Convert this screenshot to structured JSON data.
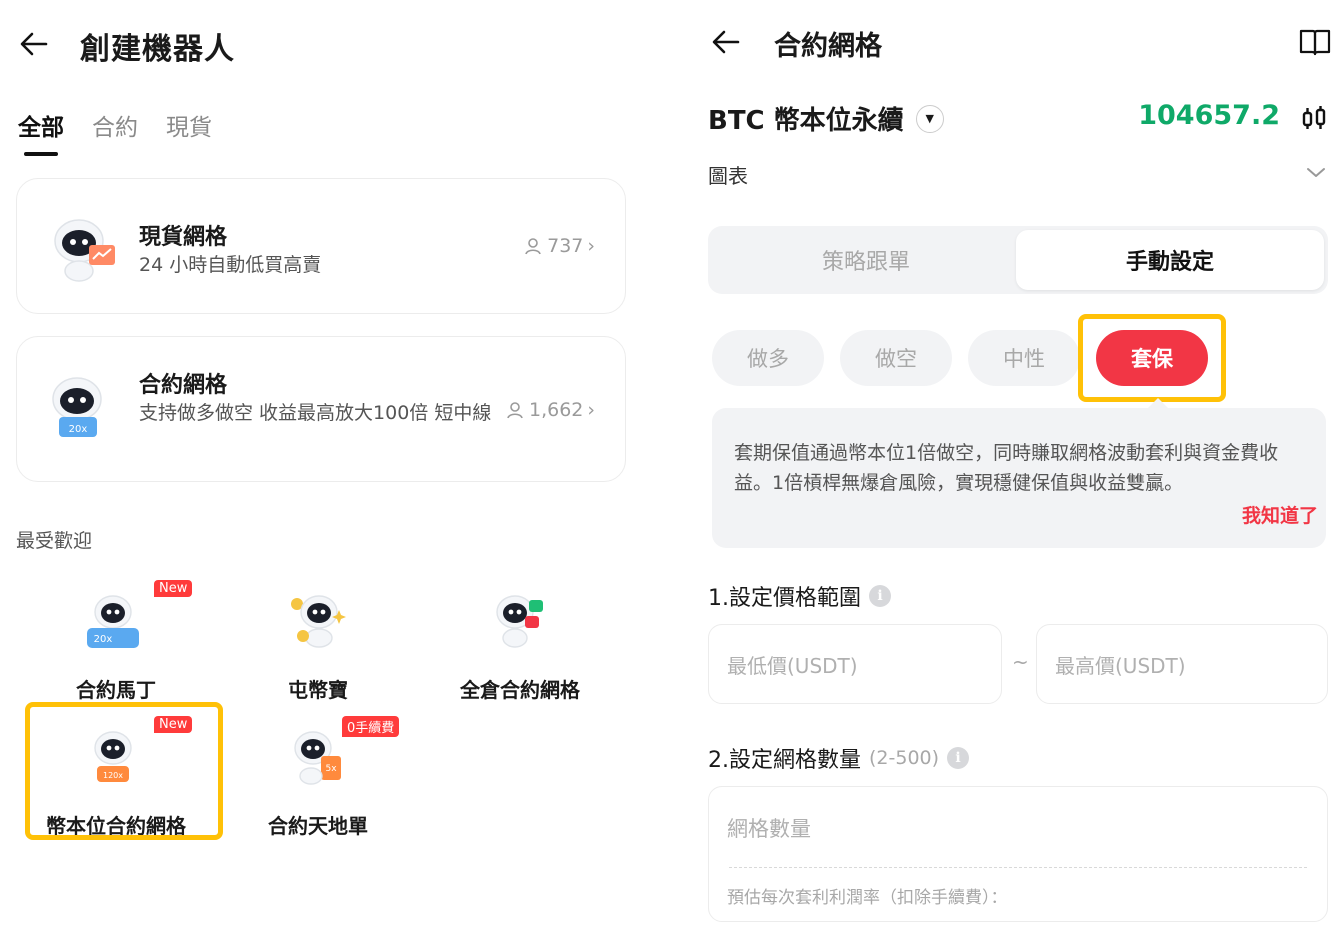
{
  "left": {
    "header": {
      "title": "創建機器人"
    },
    "tabs": [
      {
        "label": "全部",
        "active": true
      },
      {
        "label": "合約",
        "active": false
      },
      {
        "label": "現貨",
        "active": false
      }
    ],
    "cards": [
      {
        "title": "現貨網格",
        "subtitle": "24 小時自動低買高賣",
        "count": "737"
      },
      {
        "title": "合約網格",
        "subtitle": "支持做多做空 收益最高放大100倍 短中線",
        "count": "1,662"
      }
    ],
    "section_label": "最受歡迎",
    "popular": [
      {
        "label": "合約馬丁",
        "badge": "New"
      },
      {
        "label": "屯幣寶",
        "badge": ""
      },
      {
        "label": "全倉合約網格",
        "badge": ""
      },
      {
        "label": "幣本位合約網格",
        "badge": "New"
      },
      {
        "label": "合約天地單",
        "badge": "0手續費"
      }
    ],
    "robot_tags": {
      "r1": "20x",
      "r2": "20x",
      "r3": "20x",
      "r4": "120x",
      "r5": "5x"
    }
  },
  "right": {
    "header": {
      "title": "合約網格"
    },
    "pair": "BTC 幣本位永續",
    "price": "104657.2",
    "chart_label": "圖表",
    "segments": [
      {
        "label": "策略跟單",
        "active": false
      },
      {
        "label": "手動設定",
        "active": true
      }
    ],
    "modes": [
      {
        "label": "做多",
        "active": false
      },
      {
        "label": "做空",
        "active": false
      },
      {
        "label": "中性",
        "active": false
      },
      {
        "label": "套保",
        "active": true
      }
    ],
    "tip": {
      "text": "套期保值通過幣本位1倍做空，同時賺取網格波動套利與資金費收益。1倍槓桿無爆倉風險，實現穩健保值與收益雙贏。",
      "link": "我知道了"
    },
    "step1": {
      "label": "1.設定價格範圍",
      "min_placeholder": "最低價(USDT)",
      "max_placeholder": "最高價(USDT)",
      "separator": "~"
    },
    "step2": {
      "label": "2.設定網格數量",
      "hint": "(2-500)",
      "placeholder": "網格數量",
      "estimate": "預估每次套利利潤率（扣除手續費）："
    }
  },
  "colors": {
    "accent_red": "#f23645",
    "price_green": "#0fa968",
    "highlight": "#ffc107"
  }
}
